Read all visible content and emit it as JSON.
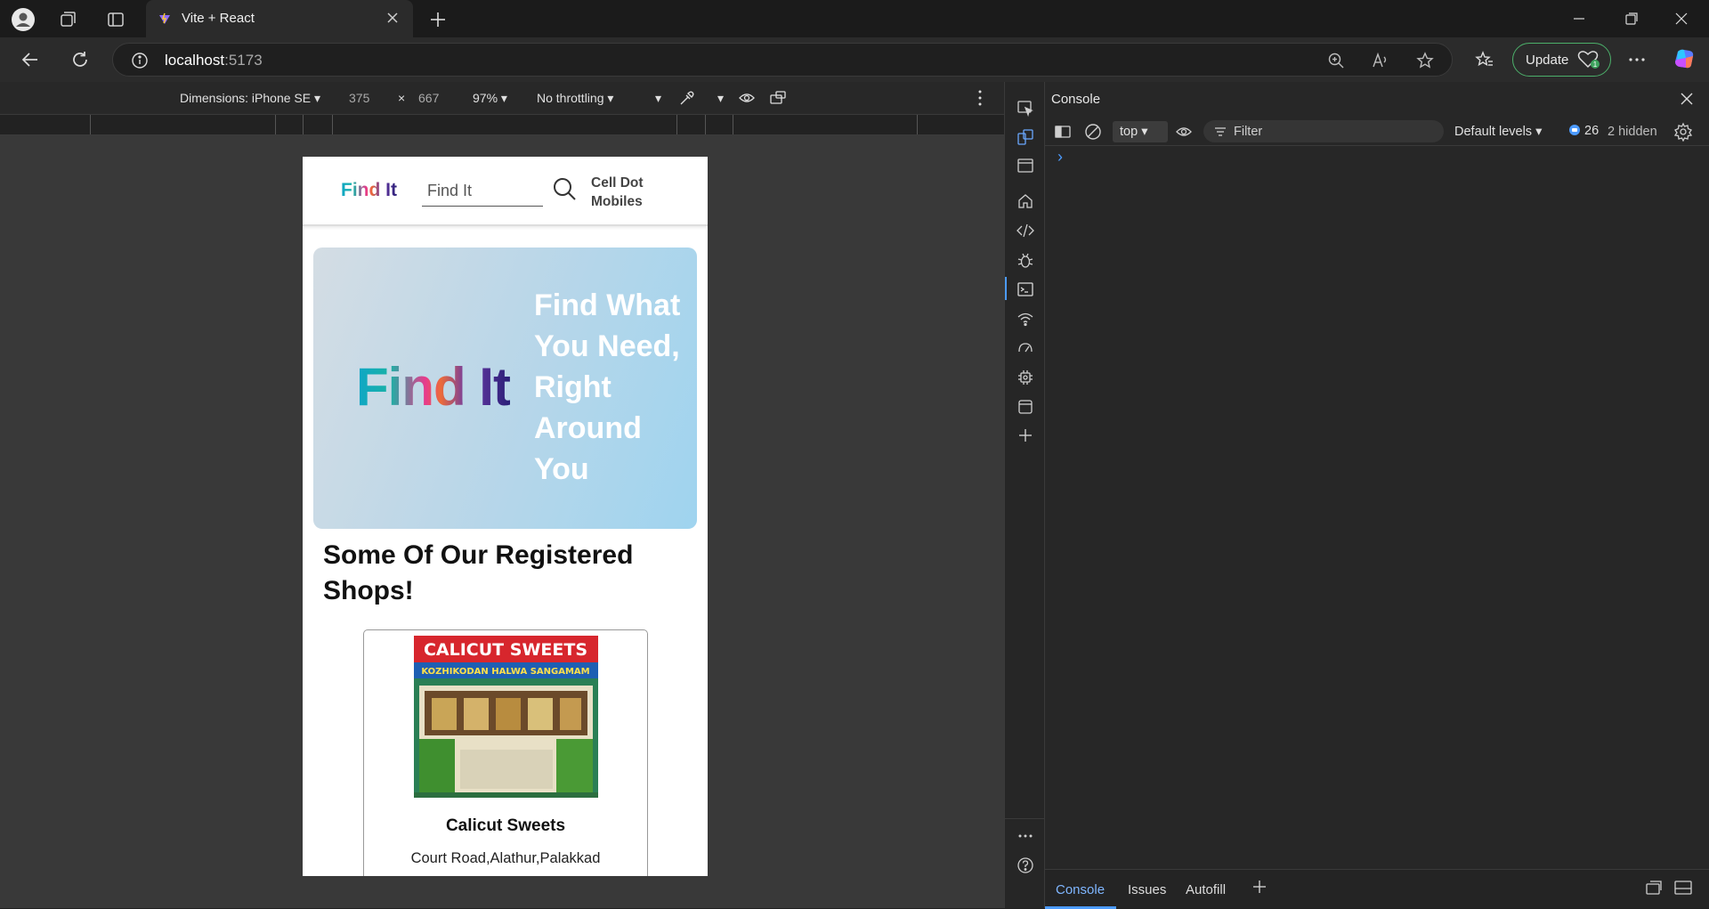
{
  "browser": {
    "tab_title": "Vite + React",
    "address_host": "localhost",
    "address_port": ":5173",
    "update_label": "Update"
  },
  "device_toolbar": {
    "dimensions_label": "Dimensions: iPhone SE",
    "width": "375",
    "times": "×",
    "height": "667",
    "zoom": "97%",
    "throttling": "No throttling"
  },
  "page": {
    "header": {
      "logo": "Find It",
      "search_placeholder": "Find It",
      "shop_name": "Cell Dot Mobiles"
    },
    "hero": {
      "logo": "Find It",
      "tagline": "Find What You Need, Right Around You"
    },
    "section_title": "Some Of Our Registered Shops!",
    "shops": [
      {
        "sign_line1": "CALICUT SWEETS",
        "sign_line2": "KOZHIKODAN HALWA SANGAMAM",
        "name": "Calicut Sweets",
        "address": "Court Road,Alathur,Palakkad"
      }
    ]
  },
  "devtools": {
    "panel_title": "Console",
    "context": "top",
    "filter_placeholder": "Filter",
    "levels": "Default levels",
    "message_count": "26",
    "hidden": "2 hidden",
    "prompt": "›",
    "bottom_tabs": [
      "Console",
      "Issues",
      "Autofill"
    ]
  },
  "colors": {
    "accent_blue": "#4c9bff",
    "update_border": "#4caf6a",
    "hero_gradient_end": "#9fd4ef"
  }
}
